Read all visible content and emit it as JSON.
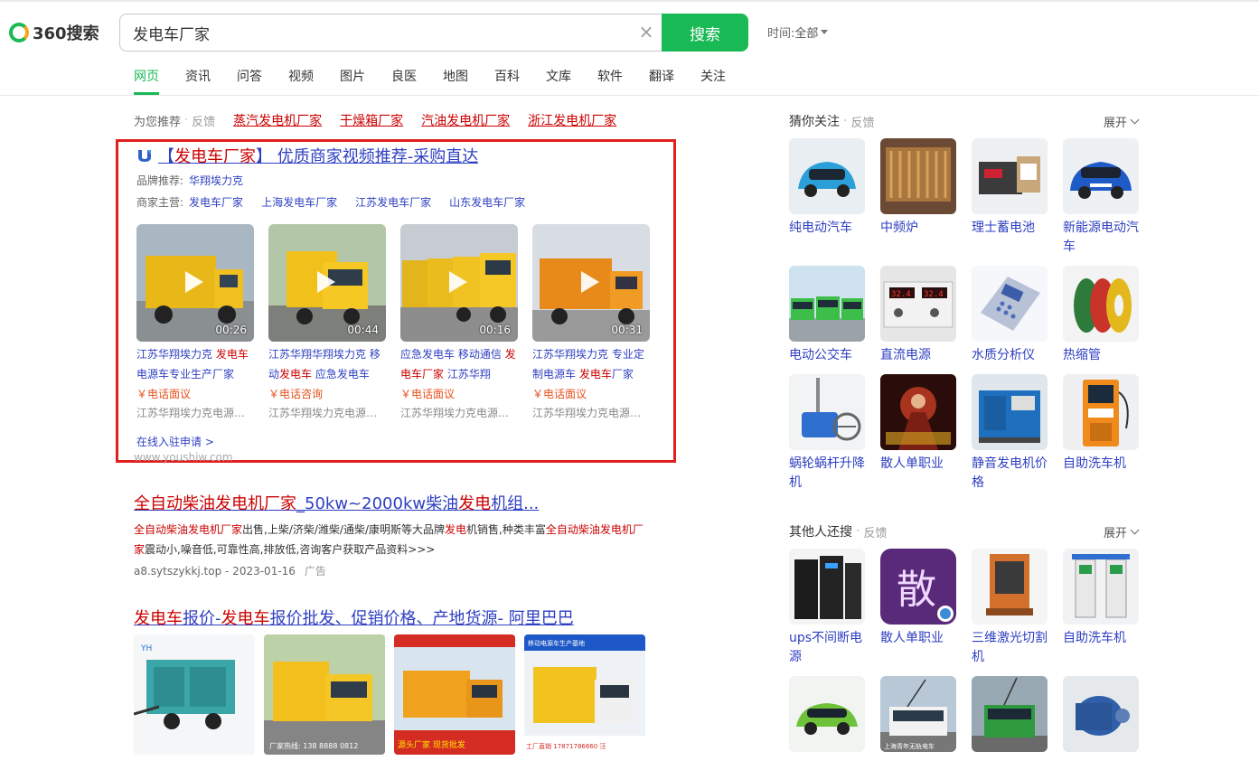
{
  "header": {
    "logo_text": "360搜索",
    "query": "发电车厂家",
    "clear_glyph": "×",
    "search_button": "搜索",
    "time_filter_label": "时间:",
    "time_filter_value": "全部"
  },
  "tabs": [
    "网页",
    "资讯",
    "问答",
    "视频",
    "图片",
    "良医",
    "地图",
    "百科",
    "文库",
    "软件",
    "翻译",
    "关注"
  ],
  "recommendations": {
    "label": "为您推荐",
    "sep": "·",
    "feedback": "反馈",
    "links": [
      "蒸汽发电机厂家",
      "干燥箱厂家",
      "汽油发电机厂家",
      "浙江发电机厂家"
    ]
  },
  "ad": {
    "title_pre": "【",
    "title_hl": "发电车厂家",
    "title_post": "】 优质商家视频推荐-采购直达",
    "brand_label": "品牌推荐:",
    "brand_value": "华翔埃力克",
    "main_label": "商家主营:",
    "main_links": [
      "发电车厂家",
      "上海发电车厂家",
      "江苏发电车厂家",
      "山东发电车厂家"
    ],
    "videos": [
      {
        "duration": "00:26",
        "desc_a": "江苏华翔埃力克 ",
        "desc_hl": "发电车",
        "desc_b": " 电源车专业生产厂家",
        "price": "￥电话面议",
        "company": "江苏华翔埃力克电源科技有限公司"
      },
      {
        "duration": "00:44",
        "desc_a": "江苏华翔华翔埃力克 移动",
        "desc_hl": "发电车",
        "desc_b": " 应急发电车",
        "price": "￥电话咨询",
        "company": "江苏华翔埃力克电源科技有限公司"
      },
      {
        "duration": "00:16",
        "desc_a": "应急发电车 移动通信 ",
        "desc_hl": "发电车厂家",
        "desc_b": " 江苏华翔",
        "price": "￥电话面议",
        "company": "江苏华翔埃力克电源科技有限公司"
      },
      {
        "duration": "00:31",
        "desc_a": "江苏华翔埃力克 专业定制电源车 ",
        "desc_hl": "发电车",
        "desc_b": "厂家",
        "price": "￥电话面议",
        "company": "江苏华翔埃力克电源科技有限公司"
      }
    ],
    "apply_link": "在线入驻申请 >",
    "url": "www.youshiw.com"
  },
  "result2": {
    "title_hl1": "全自动柴油发电机厂家",
    "title_mid": "_50kw~2000kw柴油",
    "title_hl2": "发电",
    "title_end": "机组...",
    "snippet_hl1": "全自动柴油发电机厂家",
    "snippet_a": "出售,上柴/济柴/潍柴/通柴/康明斯等大品牌",
    "snippet_hl2": "发电",
    "snippet_b": "机销售,种类丰富",
    "snippet_hl3": "全自动柴油发电机厂家",
    "snippet_c": "震动小,噪音低,可靠性高,排放低,咨询客户获取产品资料>>>",
    "url": "a8.sytszykkj.top - 2023-01-16",
    "ad_label": "广告"
  },
  "result3": {
    "t1": "发电车",
    "t2": "报价-",
    "t3": "发电车",
    "t4": "报价批发、促销价格、产地货源- 阿里巴巴",
    "image_captions": [
      "厂家热线: 138 8888 0812",
      "源头厂家 现货批发",
      "移动电源车生产基地 工厂直销 17871786660 汪"
    ]
  },
  "sidebar": {
    "guess_title": "猜你关注",
    "others_title": "其他人还搜",
    "sep": "·",
    "feedback": "反馈",
    "expand": "展开",
    "guess_items": [
      "纯电动汽车",
      "中频炉",
      "理士蓄电池",
      "新能源电动汽车",
      "电动公交车",
      "直流电源",
      "水质分析仪",
      "热缩管",
      "蜗轮蜗杆升降机",
      "散人单职业",
      "静音发电机价格",
      "自助洗车机"
    ],
    "others_items": [
      "ups不间断电源",
      "散人单职业",
      "三维激光切割机",
      "自助洗车机"
    ],
    "bottom_caption": "上海青年无轨电车"
  },
  "colors": {
    "brand": "#19b955",
    "link": "#2e3fc1",
    "highlight": "#cc0000",
    "ad_border": "#e0201e",
    "price": "#e5511d"
  }
}
